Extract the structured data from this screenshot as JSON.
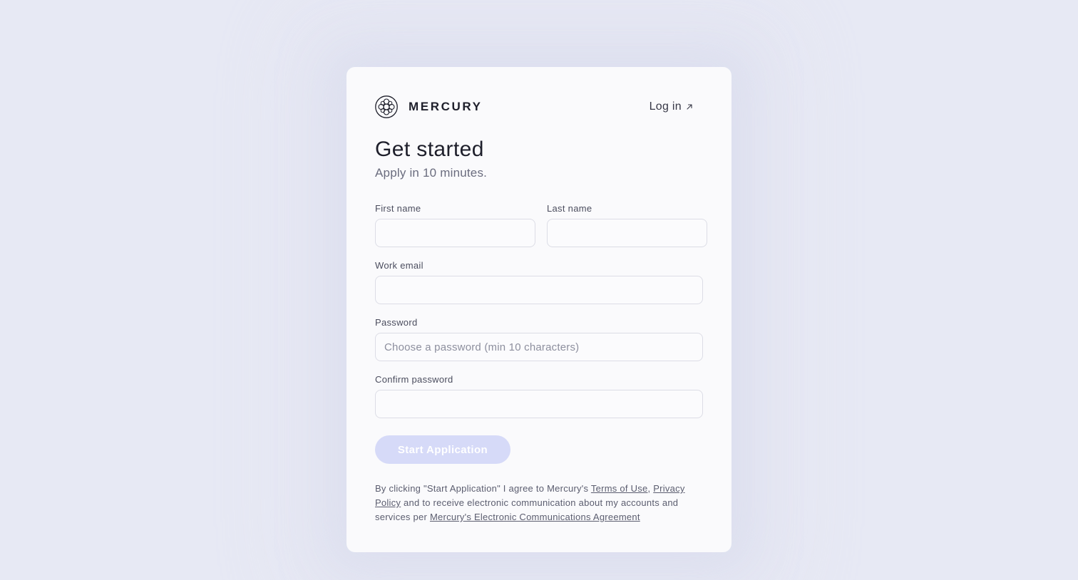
{
  "brand": {
    "name": "MERCURY"
  },
  "header": {
    "login_label": "Log in"
  },
  "page": {
    "title": "Get started",
    "subtitle": "Apply in 10 minutes."
  },
  "form": {
    "first_name_label": "First name",
    "first_name_value": "",
    "last_name_label": "Last name",
    "last_name_value": "",
    "work_email_label": "Work email",
    "work_email_value": "",
    "password_label": "Password",
    "password_placeholder": "Choose a password (min 10 characters)",
    "confirm_password_label": "Confirm password",
    "confirm_password_value": "",
    "submit_label": "Start Application"
  },
  "legal": {
    "text_before": "By clicking \"Start Application\" I agree to Mercury's ",
    "terms_link": "Terms of Use",
    "separator": ", ",
    "privacy_link": "Privacy Policy",
    "text_middle": " and to receive electronic communication about my accounts and services per ",
    "eca_link": "Mercury's Electronic Communications Agreement"
  },
  "colors": {
    "background": "#e7e9f4",
    "card": "#fafafc",
    "button_disabled": "#d6daf8",
    "text_primary": "#1e1f2b",
    "text_muted": "#6a6c7e"
  },
  "icons": {
    "logo": "mercury-logo-icon",
    "login_arrow": "arrow-up-right-icon"
  }
}
